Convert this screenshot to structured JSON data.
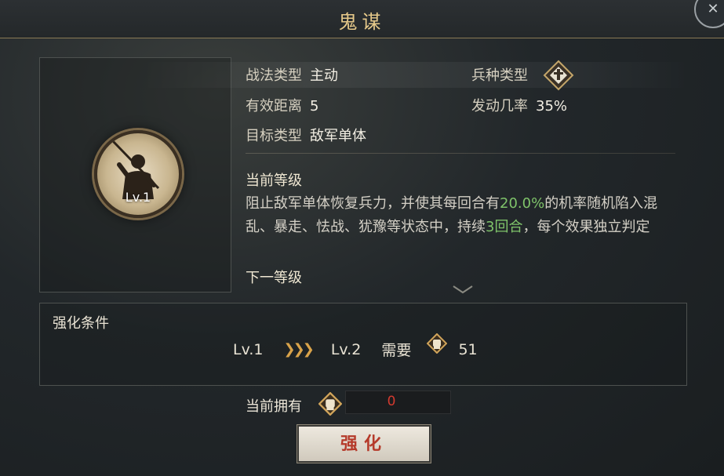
{
  "window": {
    "title": "鬼谋"
  },
  "hero": {
    "level": "Lv.1"
  },
  "info": {
    "skill_type_label": "战法类型",
    "skill_type_value": "主动",
    "troop_type_label": "兵种类型",
    "range_label": "有效距离",
    "range_value": "5",
    "trigger_label": "发动几率",
    "trigger_value": "35%",
    "target_label": "目标类型",
    "target_value": "敌军单体"
  },
  "current_level": {
    "heading": "当前等级",
    "desc_part1": "阻止敌军单体恢复兵力，并使其每回合有",
    "desc_chance": "20.0%",
    "desc_part2": "的机率随机陷入混乱、暴走、怯战、犹豫等状态中，持续",
    "desc_duration": "3回合",
    "desc_part3": "，每个效果独立判定"
  },
  "next_level": {
    "heading": "下一等级"
  },
  "upgrade": {
    "title": "强化条件",
    "from_level": "Lv.1",
    "to_level": "Lv.2",
    "need_label": "需要",
    "need_amount": "51"
  },
  "owned": {
    "label": "当前拥有",
    "value": "0"
  },
  "action": {
    "label": "强化"
  },
  "icons": {
    "close": "close-icon",
    "troop": "diamond-troop-icon",
    "fist": "fist-token-icon",
    "arrows": "triple-chevron-icon",
    "expand": "chevron-down-icon"
  },
  "colors": {
    "accent_gold": "#e6c98a",
    "highlight_green": "#7fc36a",
    "shortage_red": "#d33a2f",
    "button_text": "#b53a2a"
  }
}
